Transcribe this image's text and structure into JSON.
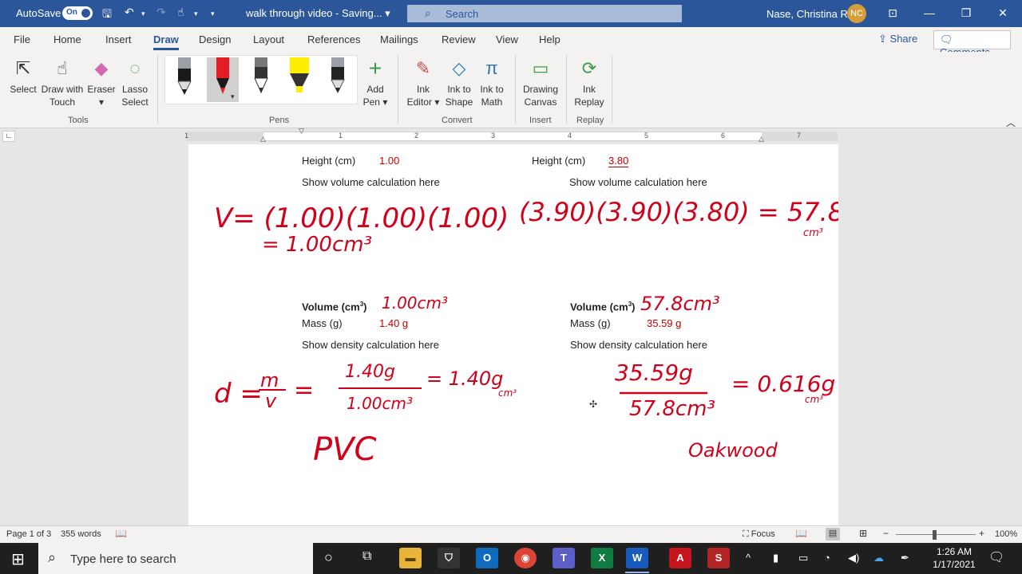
{
  "titlebar": {
    "autosave_label": "AutoSave",
    "autosave_state": "On",
    "doc_title": "walk through video  -  Saving...",
    "search_placeholder": "Search",
    "user_name": "Nase, Christina R",
    "user_initials": "NC"
  },
  "menu": {
    "tabs": [
      "File",
      "Home",
      "Insert",
      "Draw",
      "Design",
      "Layout",
      "References",
      "Mailings",
      "Review",
      "View",
      "Help"
    ],
    "active": "Draw",
    "share": "Share",
    "comments": "Comments"
  },
  "ribbon": {
    "tools": {
      "select": "Select",
      "draw_touch_1": "Draw with",
      "draw_touch_2": "Touch",
      "eraser": "Eraser",
      "lasso_1": "Lasso",
      "lasso_2": "Select",
      "group": "Tools"
    },
    "pens": {
      "group": "Pens",
      "add_pen_1": "Add",
      "add_pen_2": "Pen",
      "colors": [
        "#1a1a1a",
        "#e51c23",
        "#333333",
        "#ffee00",
        "#222222"
      ]
    },
    "convert": {
      "ink_editor_1": "Ink",
      "ink_editor_2": "Editor",
      "ink_shape_1": "Ink to",
      "ink_shape_2": "Shape",
      "ink_math_1": "Ink to",
      "ink_math_2": "Math",
      "group": "Convert"
    },
    "insert": {
      "canvas_1": "Drawing",
      "canvas_2": "Canvas",
      "group": "Insert"
    },
    "replay": {
      "replay_1": "Ink",
      "replay_2": "Replay",
      "group": "Replay"
    }
  },
  "ruler": {
    "numbers": [
      "1",
      "1",
      "2",
      "3",
      "4",
      "5",
      "6",
      "7"
    ]
  },
  "document": {
    "left": {
      "height_label": "Height (cm)",
      "height_value": "1.00",
      "volume_calc": "Show volume calculation here",
      "volume_label": "Volume (cm",
      "sup": "3",
      "volume_close": ")",
      "mass_label": "Mass (g)",
      "mass_value": "1.40 g",
      "density_calc": "Show density calculation here"
    },
    "right": {
      "height_label": "Height (cm)",
      "height_value": "3.80",
      "volume_calc": "Show volume calculation here",
      "volume_label": "Volume (cm",
      "sup": "3",
      "volume_close": ")",
      "mass_label": "Mass (g)",
      "mass_value": "35.59 g",
      "density_calc": "Show density calculation here"
    },
    "ink": {
      "left_volume_1": "V= (1.00)(1.00)(1.00)",
      "left_volume_2": "= 1.00cm³",
      "right_volume": "(3.90)(3.90)(3.80) = 57.8",
      "right_volume_unit": "cm³",
      "left_vol_written": "1.00cm³",
      "right_vol_written": "57.8cm³",
      "left_d_start": "d = ",
      "left_d_m": "m",
      "left_d_v": "v",
      "left_num": "1.40g",
      "left_den": "1.00cm³",
      "left_result": "= 1.40g",
      "left_result_unit": "cm³",
      "left_material": "PVC",
      "right_num": "35.59g",
      "right_den": "57.8cm³",
      "right_result": "= 0.616g",
      "right_result_unit": "cm³",
      "right_material": "Oakwood"
    }
  },
  "status": {
    "page": "Page 1 of 3",
    "words": "355 words",
    "focus": "Focus",
    "zoom": "100%"
  },
  "taskbar": {
    "search_placeholder": "Type here to search",
    "time": "1:26 AM",
    "date": "1/17/2021"
  }
}
